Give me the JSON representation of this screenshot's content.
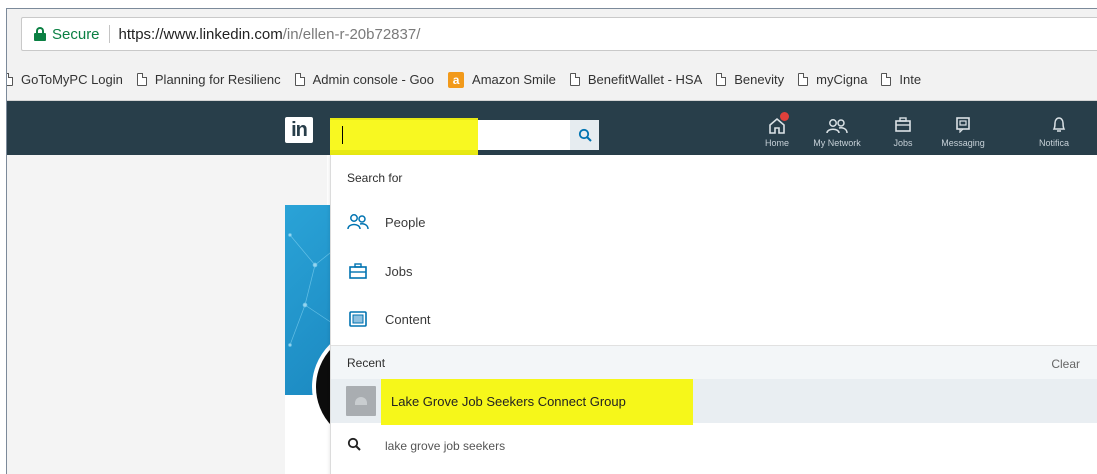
{
  "browser": {
    "secure_label": "Secure",
    "url_host": "https://www.linkedin.com",
    "url_path": "/in/ellen-r-20b72837/"
  },
  "bookmarks": [
    {
      "label": "GoToMyPC Login",
      "icon": "doc-icon"
    },
    {
      "label": "Planning for Resilienc",
      "icon": "doc-icon"
    },
    {
      "label": "Admin console - Goo",
      "icon": "doc-icon"
    },
    {
      "label": "Amazon Smile",
      "icon": "amazon-icon"
    },
    {
      "label": "BenefitWallet - HSA",
      "icon": "doc-icon"
    },
    {
      "label": "Benevity",
      "icon": "doc-icon"
    },
    {
      "label": "myCigna",
      "icon": "doc-icon"
    },
    {
      "label": "Inte",
      "icon": "doc-icon"
    }
  ],
  "linkedin": {
    "logo_text": "in",
    "search": {
      "value": ""
    },
    "nav": [
      {
        "label": "Home",
        "icon": "home-icon",
        "badge": true
      },
      {
        "label": "My Network",
        "icon": "network-icon"
      },
      {
        "label": "Jobs",
        "icon": "jobs-icon"
      },
      {
        "label": "Messaging",
        "icon": "messaging-icon"
      },
      {
        "label": "Notifica",
        "icon": "bell-icon"
      }
    ]
  },
  "dropdown": {
    "search_for_label": "Search for",
    "options": [
      {
        "label": "People",
        "icon": "people-icon"
      },
      {
        "label": "Jobs",
        "icon": "jobs-icon"
      },
      {
        "label": "Content",
        "icon": "content-icon"
      }
    ],
    "recent_label": "Recent",
    "clear_label": "Clear",
    "recent_item": "Lake Grove Job Seekers Connect Group",
    "query_suggestion": "lake grove job seekers"
  },
  "colors": {
    "linkedin_nav": "#283e4a",
    "highlight": "#f7f70e",
    "secure_green": "#0b8043",
    "icon_blue": "#0073b1"
  }
}
